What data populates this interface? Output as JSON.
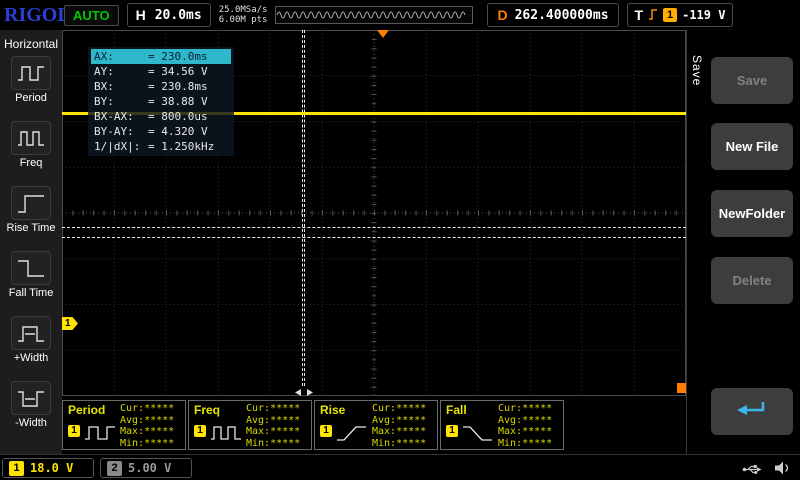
{
  "topbar": {
    "logo": "RIGOL",
    "mode_badge": "AUTO",
    "horizontal": {
      "label": "H",
      "value": "20.0ms"
    },
    "acquisition": {
      "sample_rate": "25.0MSa/s",
      "memory_depth": "6.00M pts"
    },
    "delay": {
      "label": "D",
      "value": "262.400000ms"
    },
    "trigger": {
      "label": "T",
      "source": "1",
      "level": "-119 V",
      "slope_icon": "rising-edge-icon"
    }
  },
  "left_menu": {
    "title": "Horizontal",
    "items": [
      {
        "label": "Period",
        "icon": "period-icon"
      },
      {
        "label": "Freq",
        "icon": "freq-icon"
      },
      {
        "label": "Rise Time",
        "icon": "rise-time-icon"
      },
      {
        "label": "Fall Time",
        "icon": "fall-time-icon"
      },
      {
        "label": "+Width",
        "icon": "plus-width-icon"
      },
      {
        "label": "-Width",
        "icon": "minus-width-icon"
      }
    ]
  },
  "cursor_readout": {
    "rows": [
      {
        "label": "AX:",
        "value": "= 230.0ms",
        "highlight": true
      },
      {
        "label": "AY:",
        "value": "= 34.56 V",
        "highlight": false
      },
      {
        "label": "BX:",
        "value": "= 230.8ms",
        "highlight": false
      },
      {
        "label": "BY:",
        "value": "= 38.88 V",
        "highlight": false
      },
      {
        "label": "BX-AX:",
        "value": "= 800.0us",
        "highlight": false
      },
      {
        "label": "BY-AY:",
        "value": "= 4.320 V",
        "highlight": false
      },
      {
        "label": "1/|dX|:",
        "value": "= 1.250kHz",
        "highlight": false
      }
    ]
  },
  "measurements": [
    {
      "label": "Period",
      "channel": "1",
      "stats": [
        "Cur:*****",
        "Avg:*****",
        "Max:*****",
        "Min:*****"
      ]
    },
    {
      "label": "Freq",
      "channel": "1",
      "stats": [
        "Cur:*****",
        "Avg:*****",
        "Max:*****",
        "Min:*****"
      ]
    },
    {
      "label": "Rise",
      "channel": "1",
      "stats": [
        "Cur:*****",
        "Avg:*****",
        "Max:*****",
        "Min:*****"
      ]
    },
    {
      "label": "Fall",
      "channel": "1",
      "stats": [
        "Cur:*****",
        "Avg:*****",
        "Max:*****",
        "Min:*****"
      ]
    }
  ],
  "save_menu": {
    "tab": "Save",
    "buttons": [
      {
        "label": "Save",
        "enabled": false
      },
      {
        "label": "New File",
        "enabled": true
      },
      {
        "label": "NewFolder",
        "enabled": true
      },
      {
        "label": "Delete",
        "enabled": false
      },
      {
        "label": "",
        "icon": "return-arrow-icon",
        "enabled": true
      }
    ]
  },
  "status_bar": {
    "ch1": {
      "number": "1",
      "scale": "18.0 V"
    },
    "ch2": {
      "number": "2",
      "scale": "5.00 V"
    },
    "icons": [
      "usb-icon",
      "speaker-icon"
    ]
  },
  "colors": {
    "ch1_yellow": "#ffe400",
    "ch2_disabled_gray": "#9a9a9a",
    "trigger_orange": "#ff7d00",
    "auto_green": "#00c800",
    "logo_blue": "#2a3fd4",
    "cursor_highlight_cyan": "#2fb8cc",
    "measure_yellow": "#d8d800"
  }
}
